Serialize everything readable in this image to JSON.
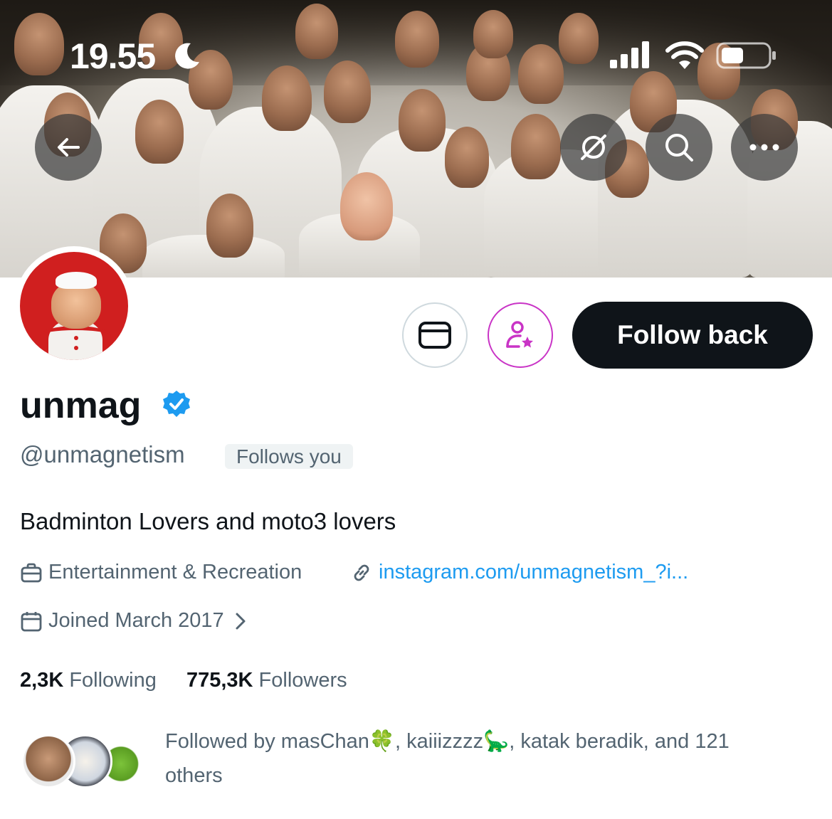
{
  "status_bar": {
    "time": "19.55"
  },
  "header_buttons": {
    "back": "arrow-left-icon",
    "translate": "globe-slash-icon",
    "search": "search-icon",
    "more": "more-dots-icon"
  },
  "actions": {
    "follow_back_label": "Follow back"
  },
  "profile": {
    "display_name": "unmag",
    "handle": "@unmagnetism",
    "follows_you": "Follows you",
    "bio": "Badminton Lovers and moto3 lovers",
    "category": "Entertainment & Recreation",
    "website": "instagram.com/unmagnetism_?i...",
    "joined": "Joined March 2017"
  },
  "stats": {
    "following_count": "2,3K",
    "following_label": "Following",
    "followers_count": "775,3K",
    "followers_label": "Followers"
  },
  "followed_by": {
    "text": "Followed by masChan🍀, kaiiizzzz🦕, katak beradik, and 121 others"
  },
  "colors": {
    "accent": "#1d9bf0",
    "subscribe_purple": "#c934c6",
    "button_dark": "#0f1419"
  }
}
